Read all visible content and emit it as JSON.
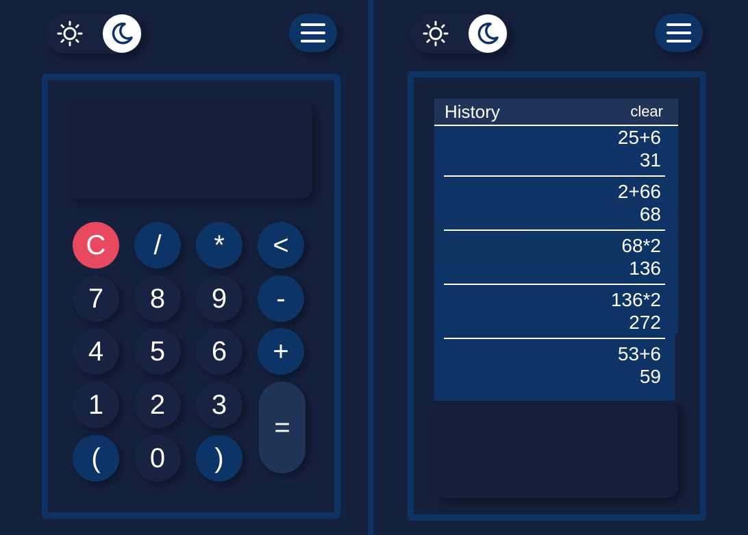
{
  "calculator": {
    "display_value": "",
    "keys": {
      "clear": "C",
      "divide": "/",
      "multiply": "*",
      "backspace": "<",
      "seven": "7",
      "eight": "8",
      "nine": "9",
      "minus": "-",
      "four": "4",
      "five": "5",
      "six": "6",
      "plus": "+",
      "one": "1",
      "two": "2",
      "three": "3",
      "equals": "=",
      "open_paren": "(",
      "zero": "0",
      "close_paren": ")"
    }
  },
  "history": {
    "title": "History",
    "clear_label": "clear",
    "entries": [
      {
        "expression": "25+6",
        "result": "31"
      },
      {
        "expression": "2+66",
        "result": "68"
      },
      {
        "expression": "68*2",
        "result": "136"
      },
      {
        "expression": "136*2",
        "result": "272"
      },
      {
        "expression": "53+6",
        "result": "59"
      }
    ]
  },
  "theme": {
    "mode": "dark",
    "icons": [
      "sun-icon",
      "moon-icon"
    ]
  },
  "colors": {
    "background": "#15203d",
    "accent": "#0f3264",
    "clear_key": "#e84860",
    "equals_key": "#203458"
  }
}
